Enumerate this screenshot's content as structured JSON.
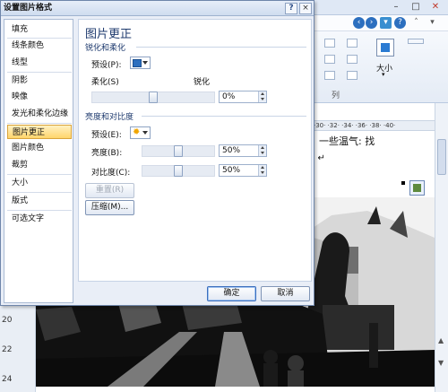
{
  "dialog": {
    "title": "设置图片格式",
    "help_glyph": "?",
    "close_glyph": "×",
    "nav_items": [
      "填充",
      "线条颜色",
      "线型",
      "阴影",
      "映像",
      "发光和柔化边缘",
      "图片更正",
      "图片颜色",
      "裁剪",
      "大小",
      "版式",
      "可选文字"
    ],
    "selected_nav": "图片更正",
    "panel_title": "图片更正",
    "sharpen_section": {
      "heading": "锐化和柔化",
      "preset_label": "预设(P):",
      "soften_label": "柔化(S)",
      "sharpen_label": "锐化",
      "value": "0%",
      "slider_level": 0.5
    },
    "brightness_section": {
      "heading": "亮度和对比度",
      "preset_label": "预设(E):",
      "brightness_label": "亮度(B):",
      "brightness_value": "50%",
      "brightness_level": 0.5,
      "contrast_label": "对比度(C):",
      "contrast_value": "50%",
      "contrast_level": 0.5
    },
    "reset_button": "重置(R)",
    "compress_button": "压缩(M)...",
    "ok_button": "确定",
    "cancel_button": "取消"
  },
  "word": {
    "window_buttons": [
      "–",
      "□",
      "✕"
    ],
    "ribbon_size_label": "大小",
    "ribbon_group_letter": "列",
    "document_text_line1": "一些温气: 找",
    "document_text_line2": "? ↵",
    "ruler_text": "·30· ·32· ·34· ·36· ·38· ·40·",
    "vruler_labels": [
      "20",
      "22",
      "24"
    ]
  }
}
